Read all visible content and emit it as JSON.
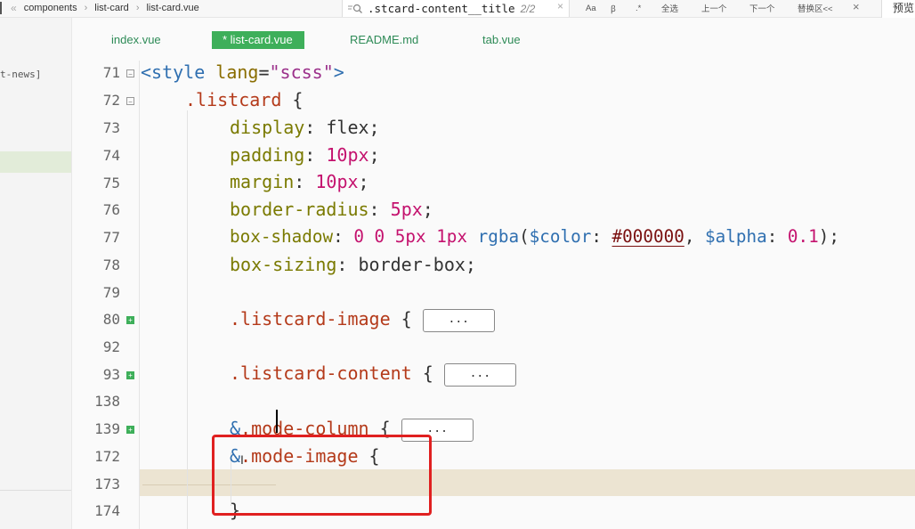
{
  "breadcrumb": {
    "back_glyph": "«",
    "items": [
      "components",
      "list-card",
      "list-card.vue"
    ],
    "separator": "›"
  },
  "find": {
    "query": ".stcard-content__title",
    "match_count": "2/2",
    "clear": "×"
  },
  "find_tools": {
    "case": "Aa",
    "word": "ꞵ",
    "regex": ".*",
    "select_all": "全选",
    "prev": "上一个",
    "next": "下一个",
    "replace": "替换区<<",
    "close": "×"
  },
  "preview_label": "预览",
  "sidebar": {
    "fragment": "t-news]"
  },
  "tabs": [
    {
      "label": "index.vue",
      "active": false
    },
    {
      "label": "* list-card.vue",
      "active": true
    },
    {
      "label": "README.md",
      "active": false
    },
    {
      "label": "tab.vue",
      "active": false
    }
  ],
  "editor": {
    "collapsed_label": "...",
    "lines": [
      {
        "n": "71",
        "fold": "minus",
        "text": "<style lang=\"scss\">"
      },
      {
        "n": "72",
        "fold": "minus",
        "text": ".listcard {"
      },
      {
        "n": "73",
        "fold": "",
        "text": "display: flex;"
      },
      {
        "n": "74",
        "fold": "",
        "text": "padding: 10px;"
      },
      {
        "n": "75",
        "fold": "",
        "text": "margin: 10px;"
      },
      {
        "n": "76",
        "fold": "",
        "text": "border-radius: 5px;"
      },
      {
        "n": "77",
        "fold": "",
        "text": "box-shadow: 0 0 5px 1px rgba($color: #000000, $alpha: 0.1);"
      },
      {
        "n": "78",
        "fold": "",
        "text": "box-sizing: border-box;"
      },
      {
        "n": "79",
        "fold": "",
        "text": ""
      },
      {
        "n": "80",
        "fold": "plus",
        "text": ".listcard-image {"
      },
      {
        "n": "92",
        "fold": "",
        "text": ""
      },
      {
        "n": "93",
        "fold": "plus",
        "text": ".listcard-content {"
      },
      {
        "n": "138",
        "fold": "",
        "text": ""
      },
      {
        "n": "139",
        "fold": "plus",
        "text": "&.mode-column {"
      },
      {
        "n": "172",
        "fold": "",
        "text": "&.mode-image {"
      },
      {
        "n": "173",
        "fold": "",
        "text": ""
      },
      {
        "n": "174",
        "fold": "",
        "text": "}"
      }
    ]
  },
  "colors": {
    "accent": "#3eaf5a",
    "highlight_box": "#e02020",
    "current_line": "#ece4d2"
  }
}
